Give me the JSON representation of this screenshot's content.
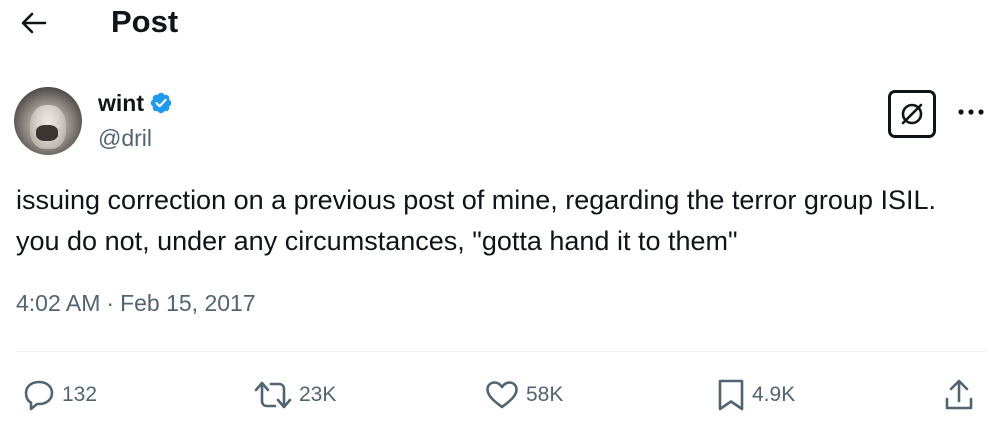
{
  "header": {
    "title": "Post",
    "back_icon": "arrow-left-icon"
  },
  "author": {
    "display_name": "wint",
    "handle": "@dril",
    "verified": true,
    "verified_color": "#1d9bf0"
  },
  "post": {
    "text": "issuing correction on a previous post of mine, regarding the terror group ISIL. you do not, under any circumstances, \"gotta hand it to them\"",
    "time": "4:02 AM",
    "separator": "·",
    "date": "Feb 15, 2017"
  },
  "stats": {
    "replies": "132",
    "reposts": "23K",
    "likes": "58K",
    "bookmarks": "4.9K"
  },
  "colors": {
    "text_primary": "#0f1419",
    "text_secondary": "#536471",
    "divider": "#eff3f4"
  }
}
